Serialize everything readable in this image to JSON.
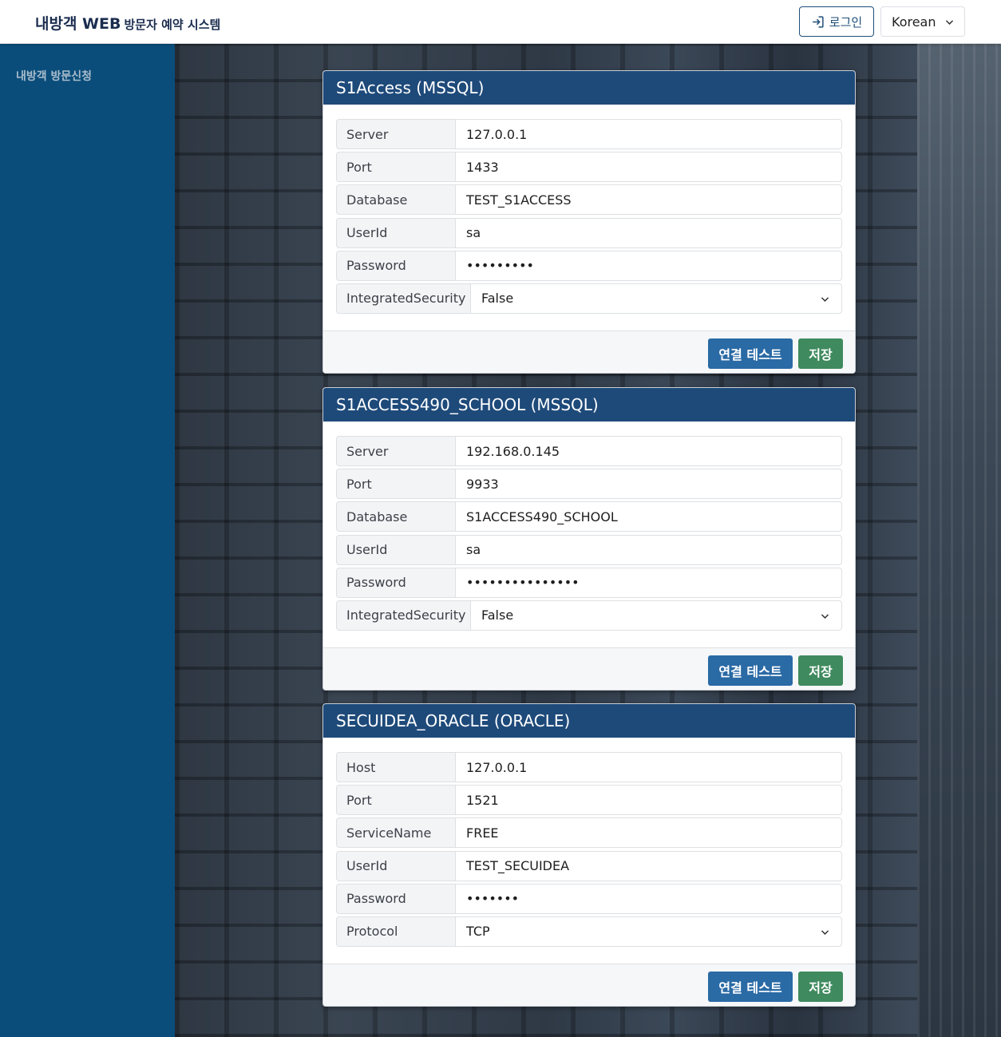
{
  "header": {
    "brand_main": "내방객 WEB",
    "brand_sub": "방문자 예약 시스템",
    "login_label": "로그인",
    "language": "Korean"
  },
  "sidebar": {
    "items": [
      {
        "label": "내방객 방문신청"
      }
    ]
  },
  "icons": {
    "login": "login-icon",
    "language_dropdown": "chevron-down-icon",
    "select_dropdown": "chevron-down-icon"
  },
  "colors": {
    "card_header": "#1e4a7a",
    "sidebar": "#0a4d7b",
    "test_button": "#2a6aa5",
    "save_button": "#3f8a5e"
  },
  "cards": [
    {
      "title": "S1Access (MSSQL)",
      "fields": [
        {
          "label": "Server",
          "value": "127.0.0.1"
        },
        {
          "label": "Port",
          "value": "1433"
        },
        {
          "label": "Database",
          "value": "TEST_S1ACCESS"
        },
        {
          "label": "UserId",
          "value": "sa"
        },
        {
          "label": "Password",
          "value": "•••••••••"
        },
        {
          "label": "IntegratedSecurity",
          "value": "False"
        }
      ],
      "test_button": "연결 테스트",
      "save_button": "저장"
    },
    {
      "title": "S1ACCESS490_SCHOOL (MSSQL)",
      "fields": [
        {
          "label": "Server",
          "value": "192.168.0.145"
        },
        {
          "label": "Port",
          "value": "9933"
        },
        {
          "label": "Database",
          "value": "S1ACCESS490_SCHOOL"
        },
        {
          "label": "UserId",
          "value": "sa"
        },
        {
          "label": "Password",
          "value": "•••••••••••••••"
        },
        {
          "label": "IntegratedSecurity",
          "value": "False"
        }
      ],
      "test_button": "연결 테스트",
      "save_button": "저장"
    },
    {
      "title": "SECUIDEA_ORACLE (ORACLE)",
      "fields": [
        {
          "label": "Host",
          "value": "127.0.0.1"
        },
        {
          "label": "Port",
          "value": "1521"
        },
        {
          "label": "ServiceName",
          "value": "FREE"
        },
        {
          "label": "UserId",
          "value": "TEST_SECUIDEA"
        },
        {
          "label": "Password",
          "value": "•••••••"
        },
        {
          "label": "Protocol",
          "value": "TCP"
        }
      ],
      "test_button": "연결 테스트",
      "save_button": "저장"
    }
  ]
}
